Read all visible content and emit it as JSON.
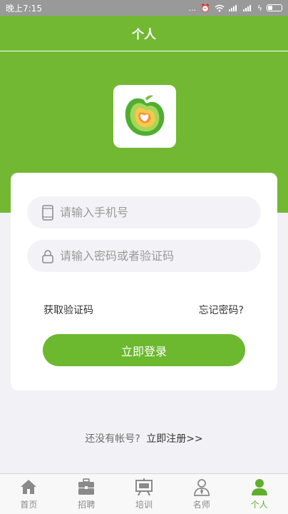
{
  "status_bar": {
    "time": "晚上7:15",
    "signal_dots": "..."
  },
  "header": {
    "title": "个人"
  },
  "login": {
    "phone_placeholder": "请输入手机号",
    "password_placeholder": "请输入密码或者验证码",
    "get_code_label": "获取验证码",
    "forgot_password_label": "忘记密码?",
    "login_button_label": "立即登录"
  },
  "register": {
    "prompt": "还没有帐号?",
    "link_label": "立即注册>>"
  },
  "tabs": [
    {
      "label": "首页",
      "icon": "home-icon",
      "active": false
    },
    {
      "label": "招聘",
      "icon": "briefcase-icon",
      "active": false
    },
    {
      "label": "培训",
      "icon": "presentation-board-icon",
      "active": false
    },
    {
      "label": "名师",
      "icon": "teacher-icon",
      "active": false
    },
    {
      "label": "个人",
      "icon": "person-icon",
      "active": true
    }
  ],
  "colors": {
    "brand_green": "#72b832",
    "button_green": "#6cb82e",
    "active_tab": "#5fae2c",
    "inactive_tab": "#8a8a8a"
  }
}
